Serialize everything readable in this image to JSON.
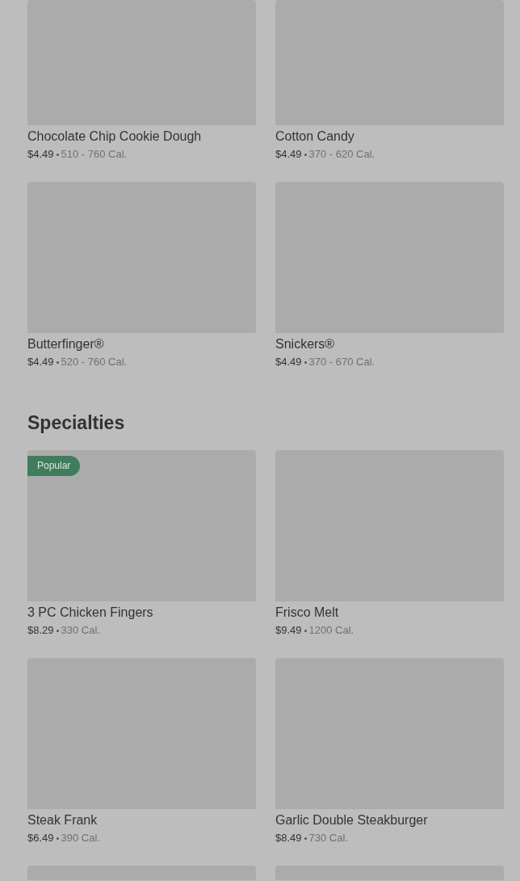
{
  "sections": [
    {
      "items": [
        {
          "kind": "item",
          "name": "Chocolate Chip Cookie Dough",
          "price": "$4.49",
          "calories": "510 - 760 Cal."
        },
        {
          "kind": "item",
          "name": "Cotton Candy",
          "price": "$4.49",
          "calories": "370 - 620 Cal."
        },
        {
          "kind": "item",
          "name": "Butterfinger®",
          "price": "$4.49",
          "calories": "520 - 760 Cal."
        },
        {
          "kind": "item",
          "name": "Snickers®",
          "price": "$4.49",
          "calories": "370 - 670 Cal."
        }
      ]
    },
    {
      "title": "Specialties",
      "items": [
        {
          "kind": "item",
          "badge": "Popular",
          "name": "3 PC Chicken Fingers",
          "price": "$8.29",
          "calories": "330 Cal."
        },
        {
          "kind": "item",
          "name": "Frisco Melt",
          "price": "$9.49",
          "calories": "1200 Cal."
        },
        {
          "kind": "item",
          "name": "Steak Frank",
          "price": "$6.49",
          "calories": "390 Cal."
        },
        {
          "kind": "item",
          "name": "Garlic Double Steakburger",
          "price": "$8.49",
          "calories": "730 Cal."
        },
        {
          "kind": "image_only"
        },
        {
          "kind": "image_only"
        }
      ]
    }
  ]
}
